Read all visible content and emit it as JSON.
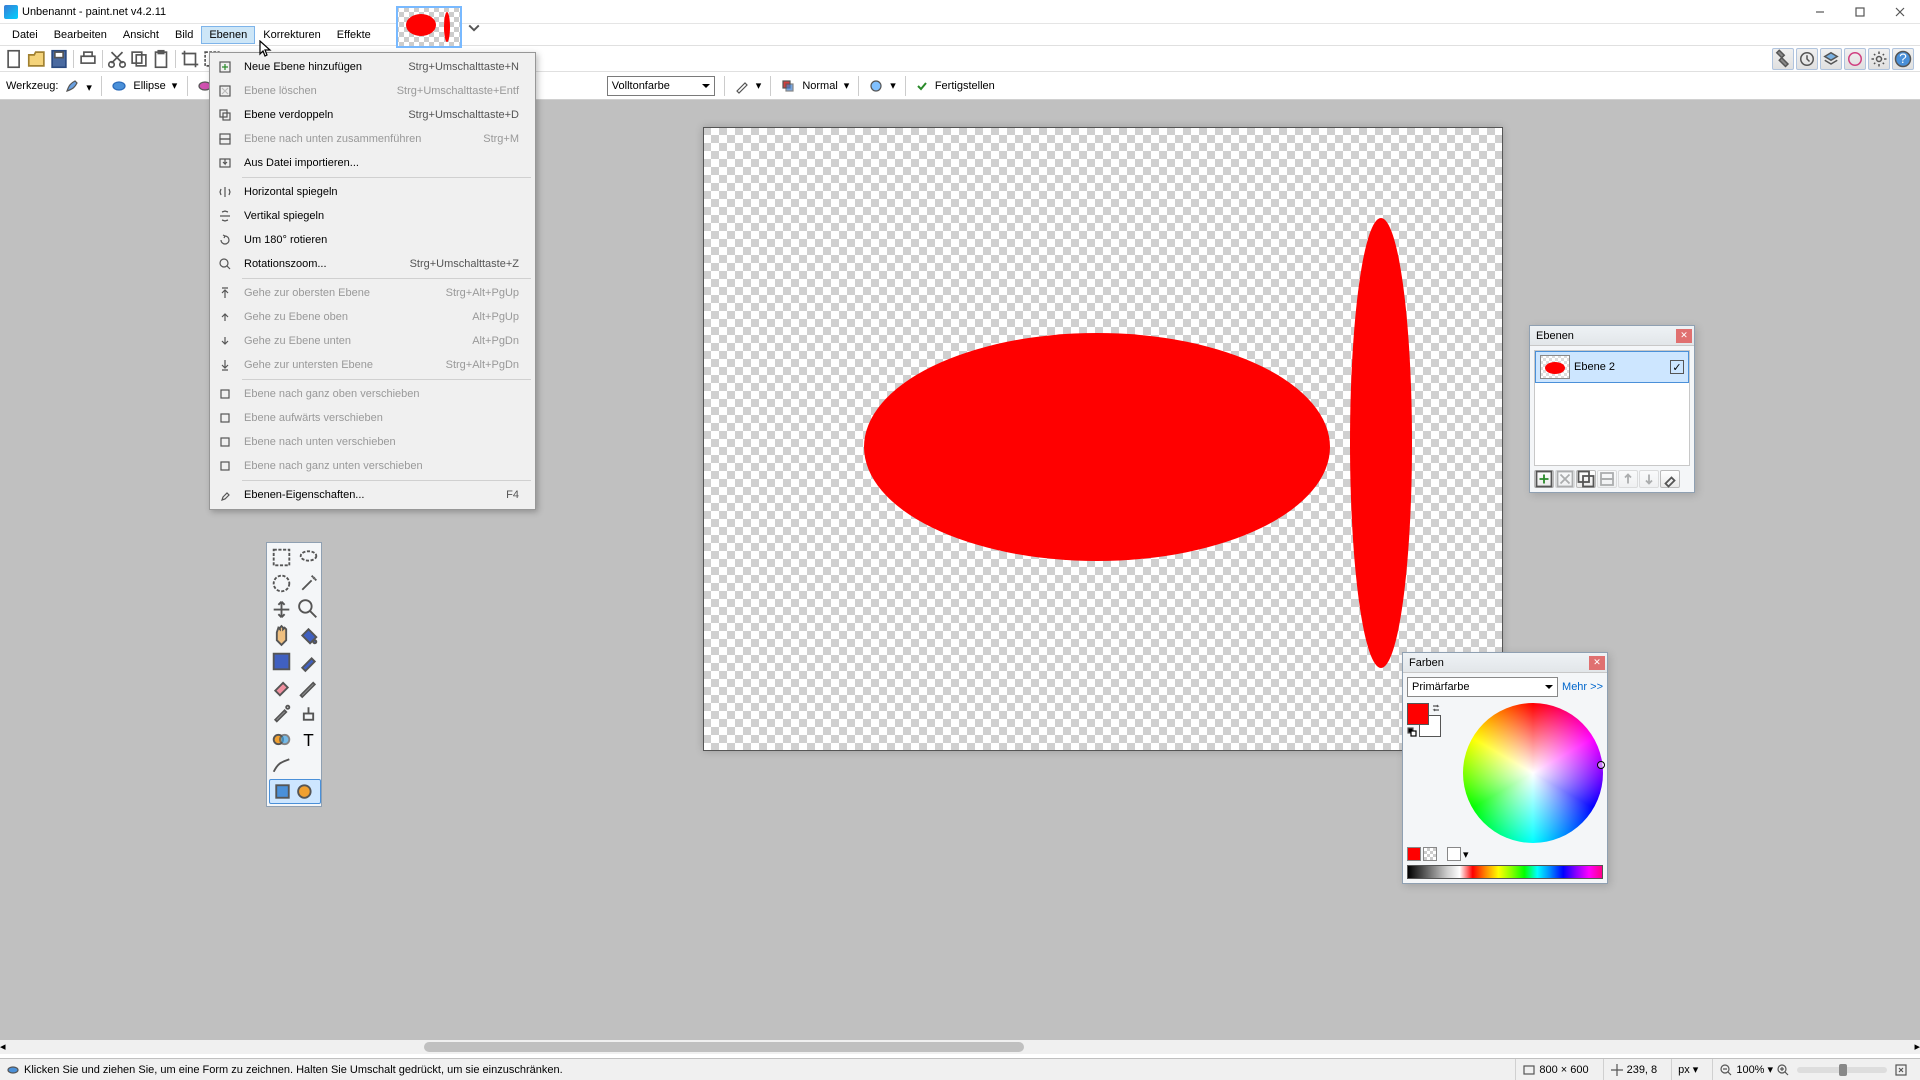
{
  "window": {
    "title": "Unbenannt - paint.net v4.2.11"
  },
  "menu": {
    "items": [
      "Datei",
      "Bearbeiten",
      "Ansicht",
      "Bild",
      "Ebenen",
      "Korrekturen",
      "Effekte"
    ],
    "active_index": 4
  },
  "dropdown": {
    "groups": [
      [
        {
          "label": "Neue Ebene hinzufügen",
          "shortcut": "Strg+Umschalttaste+N",
          "icon": "layer-new",
          "enabled": true
        },
        {
          "label": "Ebene löschen",
          "shortcut": "Strg+Umschalttaste+Entf",
          "icon": "layer-delete",
          "enabled": false
        },
        {
          "label": "Ebene verdoppeln",
          "shortcut": "Strg+Umschalttaste+D",
          "icon": "layer-dup",
          "enabled": true
        },
        {
          "label": "Ebene nach unten zusammenführen",
          "shortcut": "Strg+M",
          "icon": "layer-merge",
          "enabled": false
        },
        {
          "label": "Aus Datei importieren...",
          "shortcut": "",
          "icon": "import",
          "enabled": true
        }
      ],
      [
        {
          "label": "Horizontal spiegeln",
          "shortcut": "",
          "icon": "flip-h",
          "enabled": true
        },
        {
          "label": "Vertikal spiegeln",
          "shortcut": "",
          "icon": "flip-v",
          "enabled": true
        },
        {
          "label": "Um 180° rotieren",
          "shortcut": "",
          "icon": "rotate",
          "enabled": true
        },
        {
          "label": "Rotationszoom...",
          "shortcut": "Strg+Umschalttaste+Z",
          "icon": "rotzoom",
          "enabled": true
        }
      ],
      [
        {
          "label": "Gehe zur obersten Ebene",
          "shortcut": "Strg+Alt+PgUp",
          "icon": "go-top",
          "enabled": false
        },
        {
          "label": "Gehe zu Ebene oben",
          "shortcut": "Alt+PgUp",
          "icon": "go-up",
          "enabled": false
        },
        {
          "label": "Gehe zu Ebene unten",
          "shortcut": "Alt+PgDn",
          "icon": "go-down",
          "enabled": false
        },
        {
          "label": "Gehe zur untersten Ebene",
          "shortcut": "Strg+Alt+PgDn",
          "icon": "go-bottom",
          "enabled": false
        }
      ],
      [
        {
          "label": "Ebene nach ganz oben verschieben",
          "shortcut": "",
          "icon": "move-top",
          "enabled": false
        },
        {
          "label": "Ebene aufwärts verschieben",
          "shortcut": "",
          "icon": "move-up",
          "enabled": false
        },
        {
          "label": "Ebene nach unten verschieben",
          "shortcut": "",
          "icon": "move-down",
          "enabled": false
        },
        {
          "label": "Ebene nach ganz unten verschieben",
          "shortcut": "",
          "icon": "move-bottom",
          "enabled": false
        }
      ],
      [
        {
          "label": "Ebenen-Eigenschaften...",
          "shortcut": "F4",
          "icon": "properties",
          "enabled": true
        }
      ]
    ]
  },
  "options": {
    "tool_label": "Werkzeug:",
    "shape_label": "Ellipse",
    "fill_label": "Volltonfarbe",
    "mode_label": "Normal",
    "finish_label": "Fertigstellen"
  },
  "layers": {
    "title": "Ebenen",
    "rows": [
      {
        "name": "Ebene 2",
        "visible": true
      }
    ]
  },
  "colors": {
    "title": "Farben",
    "selector": "Primärfarbe",
    "more": "Mehr >>",
    "primary": "#ff0000",
    "secondary": "#ffffff"
  },
  "status": {
    "hint": "Klicken Sie und ziehen Sie, um eine Form zu zeichnen. Halten Sie Umschalt gedrückt, um sie einzuschränken.",
    "size": "800 × 600",
    "coords": "239, 8",
    "unit": "px",
    "zoom": "100%"
  }
}
